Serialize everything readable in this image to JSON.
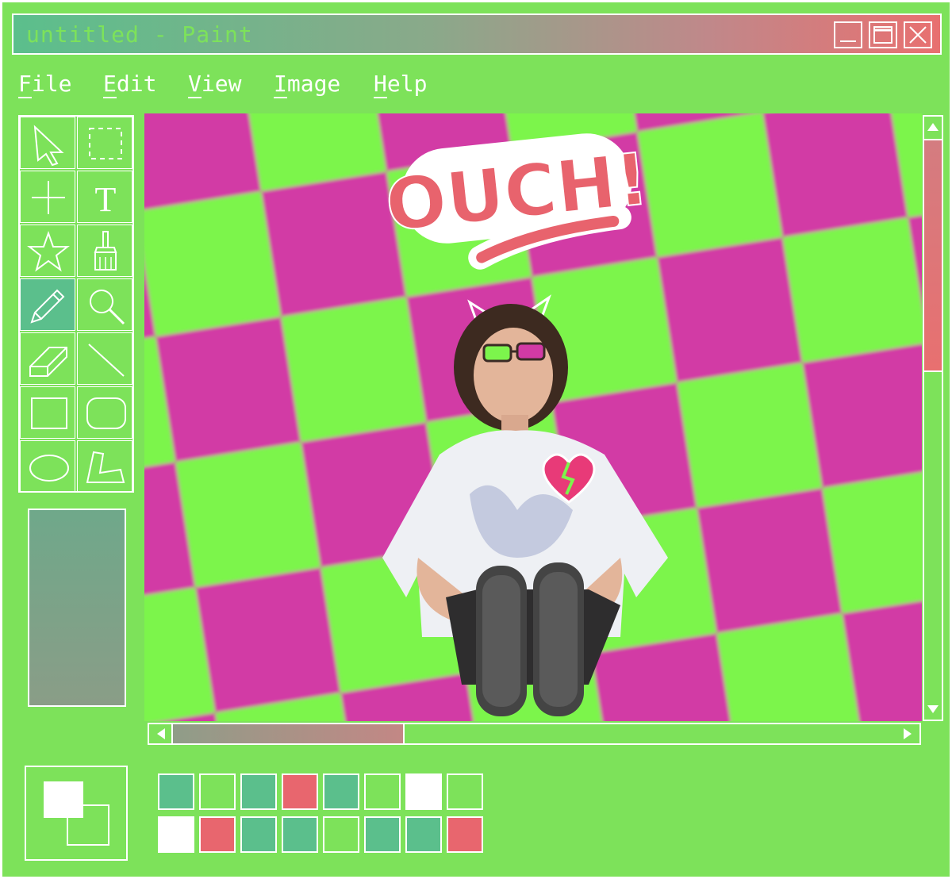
{
  "window": {
    "title": "untitled - Paint",
    "controls": [
      "minimize-icon",
      "maximize-icon",
      "close-icon"
    ]
  },
  "menu": [
    {
      "label": "File",
      "accel": "F",
      "rest": "ile"
    },
    {
      "label": "Edit",
      "accel": "E",
      "rest": "dit"
    },
    {
      "label": "View",
      "accel": "V",
      "rest": "iew"
    },
    {
      "label": "Image",
      "accel": "I",
      "rest": "mage"
    },
    {
      "label": "Help",
      "accel": "H",
      "rest": "elp"
    }
  ],
  "tools": [
    {
      "name": "select-arrow-icon"
    },
    {
      "name": "rect-select-icon"
    },
    {
      "name": "crosshair-icon"
    },
    {
      "name": "text-icon",
      "glyph": "T"
    },
    {
      "name": "star-icon"
    },
    {
      "name": "brush-icon"
    },
    {
      "name": "pencil-icon",
      "active": true
    },
    {
      "name": "magnifier-icon"
    },
    {
      "name": "eraser-icon"
    },
    {
      "name": "line-icon"
    },
    {
      "name": "rectangle-icon"
    },
    {
      "name": "rounded-rect-icon"
    },
    {
      "name": "ellipse-icon"
    },
    {
      "name": "polygon-icon"
    }
  ],
  "canvas": {
    "sticker_text": "OUCH!",
    "background": "checkerboard",
    "colors": {
      "magenta": "#d23aa5",
      "green": "#7cf54c",
      "sticker": "#e8636d",
      "heart_pink": "#e83a78"
    }
  },
  "scrollbars": {
    "vertical_position": 0.0,
    "horizontal_position": 0.0
  },
  "palette": {
    "row1": [
      "#5bbf8c",
      "#7de25a",
      "#5bbf8c",
      "#e8666e",
      "#5bbf8c",
      "#7de25a",
      "#ffffff",
      "#7de25a"
    ],
    "row2": [
      "#ffffff",
      "#e8666e",
      "#5bbf8c",
      "#5bbf8c",
      "#7de25a",
      "#5bbf8c",
      "#5bbf8c",
      "#e8666e"
    ]
  },
  "colors": {
    "accent": "#7de25a",
    "teal": "#5bbf8c",
    "red": "#e8666e",
    "line": "#ffffff"
  }
}
